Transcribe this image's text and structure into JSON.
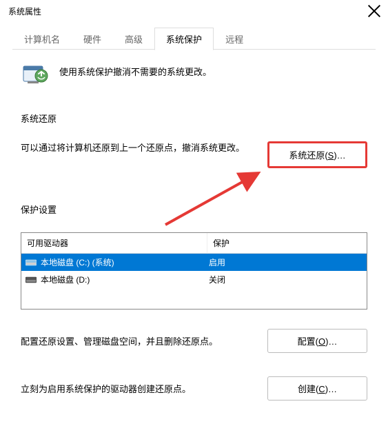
{
  "window": {
    "title": "系统属性"
  },
  "tabs": {
    "items": [
      {
        "label": "计算机名"
      },
      {
        "label": "硬件"
      },
      {
        "label": "高级"
      },
      {
        "label": "系统保护"
      },
      {
        "label": "远程"
      }
    ]
  },
  "intro": {
    "text": "使用系统保护撤消不需要的系统更改。"
  },
  "sections": {
    "restore": {
      "title": "系统还原",
      "desc": "可以通过将计算机还原到上一个还原点，撤消系统更改。",
      "button_label": "系统还原(",
      "button_mnemonic": "S",
      "button_suffix": ")…"
    },
    "settings": {
      "title": "保护设置",
      "table": {
        "col_drive": "可用驱动器",
        "col_status": "保护",
        "rows": [
          {
            "name": "本地磁盘 (C:) (系统)",
            "status": "启用",
            "selected": true
          },
          {
            "name": "本地磁盘 (D:)",
            "status": "关闭",
            "selected": false
          }
        ]
      },
      "config_desc": "配置还原设置、管理磁盘空间，并且删除还原点。",
      "config_button_label": "配置(",
      "config_button_mnemonic": "O",
      "config_button_suffix": ")…",
      "create_desc": "立刻为启用系统保护的驱动器创建还原点。",
      "create_button_label": "创建(",
      "create_button_mnemonic": "C",
      "create_button_suffix": ")…"
    }
  }
}
